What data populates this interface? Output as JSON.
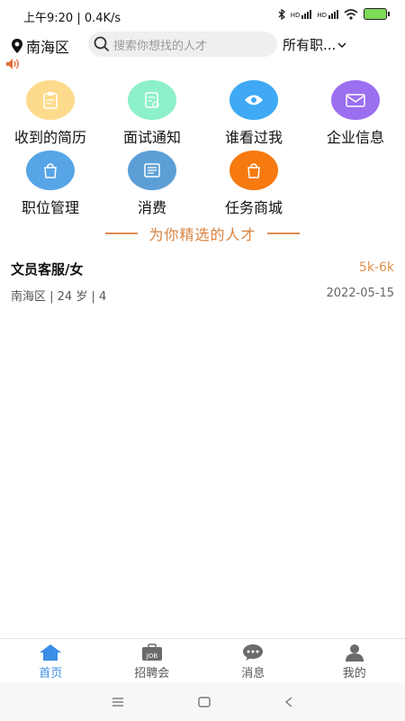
{
  "status": {
    "time": "上午9:20 | 0.4K/s",
    "signal1": "HD",
    "signal2": "HD"
  },
  "header": {
    "location": "南海区",
    "search_placeholder": "搜索你想找的人才",
    "filter": "所有职..."
  },
  "grid": [
    {
      "label": "收到的简历",
      "color": "#fddb8c",
      "icon": "clipboard-icon"
    },
    {
      "label": "面试通知",
      "color": "#8cf0c9",
      "icon": "document-icon"
    },
    {
      "label": "谁看过我",
      "color": "#3fa9f5",
      "icon": "eye-icon"
    },
    {
      "label": "企业信息",
      "color": "#9b6ff0",
      "icon": "envelope-icon"
    },
    {
      "label": "职位管理",
      "color": "#57a5e6",
      "icon": "bag-icon"
    },
    {
      "label": "消费",
      "color": "#5b9fd6",
      "icon": "receipt-icon"
    },
    {
      "label": "任务商城",
      "color": "#f67a0f",
      "icon": "bag-icon"
    }
  ],
  "section_title": "为你精选的人才",
  "candidates": [
    {
      "title": "文员客服/女",
      "salary": "5k-6k",
      "meta": "南海区 | 24 岁 | 4",
      "date": "2022-05-15"
    }
  ],
  "tabs": [
    {
      "label": "首页",
      "icon": "home-icon",
      "active": true
    },
    {
      "label": "招聘会",
      "icon": "job-fair-icon",
      "active": false
    },
    {
      "label": "消息",
      "icon": "message-icon",
      "active": false
    },
    {
      "label": "我的",
      "icon": "user-icon",
      "active": false
    }
  ],
  "colors": {
    "accent": "#3a8ee6",
    "section": "#d9823f",
    "salary": "#e3914d"
  }
}
